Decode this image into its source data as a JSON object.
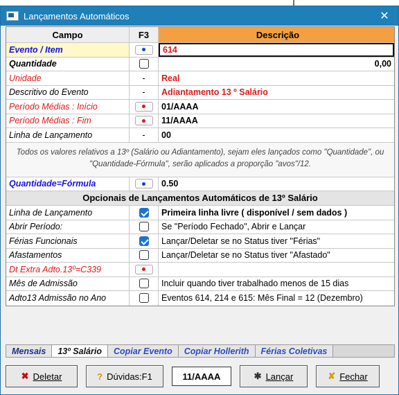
{
  "window": {
    "title": "Lançamentos Automáticos",
    "close": "✕"
  },
  "header": {
    "campo": "Campo",
    "f3": "F3",
    "descricao": "Descrição"
  },
  "rows": [
    {
      "label": "Evento / Item",
      "value": "614"
    },
    {
      "label": "Quantidade",
      "value": "0,00"
    },
    {
      "label": "Unidade",
      "f3": "-",
      "value": "Real"
    },
    {
      "label": "Descritivo do Evento",
      "f3": "-",
      "value": "Adiantamento 13 º Salário"
    },
    {
      "label": "Período Médias : Início",
      "value": "01/AAAA"
    },
    {
      "label": "Período Médias : Fim",
      "value": "11/AAAA"
    },
    {
      "label": "Linha de Lançamento",
      "f3": "-",
      "value": "00"
    }
  ],
  "note": "Todos os valores relativos a 13º (Salário ou Adiantamento), sejam eles lançados como \"Quantidade\", ou \"Quantidade-Fórmula\", serão aplicados a proporção \"avos\"/12.",
  "formula": {
    "label": "Quantidade=Fórmula",
    "value": "0.50"
  },
  "section_title": "Opcionais de Lançamentos Automáticos de 13º Salário",
  "options": [
    {
      "label": "Linha de Lançamento",
      "value": "Primeira linha livre ( disponível / sem dados )",
      "checked": true
    },
    {
      "label": "Abrir Período:",
      "value": "Se \"Período Fechado\", Abrir e Lançar",
      "checked": false
    },
    {
      "label": "Férias Funcionais",
      "value": "Lançar/Deletar se no Status tiver \"Férias\"",
      "checked": true
    },
    {
      "label": "Afastamentos",
      "value": "Lançar/Deletar se no Status tiver \"Afastado\"",
      "checked": false
    },
    {
      "label": "Dt Extra Adto.13º=C339",
      "value": ""
    },
    {
      "label": "Mês de Admissão",
      "value": "Incluir quando tiver trabalhado menos de 15 dias",
      "checked": false
    },
    {
      "label": "Adto13 Admissão no Ano",
      "value": "Eventos 614, 214 e 615: Mês Final = 12 (Dezembro)",
      "checked": false
    }
  ],
  "tabs": [
    "Mensais",
    "13º Salário",
    "Copiar Evento",
    "Copiar Hollerith",
    "Férias Coletivas"
  ],
  "buttons": {
    "deletar": "Deletar",
    "duvidas": "Dúvidas:F1",
    "periodo": "11/AAAA",
    "lancar": "Lançar",
    "fechar": "Fechar"
  },
  "colors": {
    "title_bar": "#1f7fb8",
    "header_desc": "#f5a040",
    "label_red": "#e01818",
    "label_blue": "#1414e6"
  }
}
